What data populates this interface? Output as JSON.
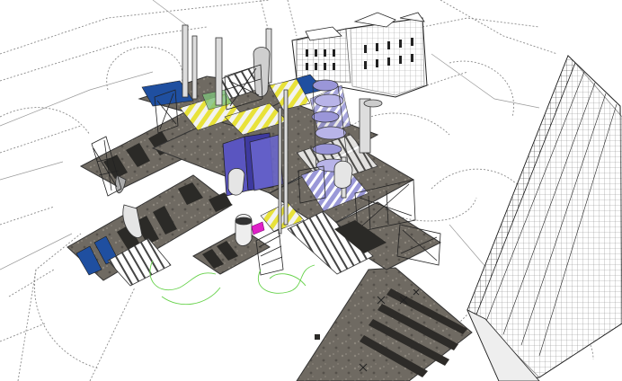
{
  "viewport": {
    "description_visible_text": ""
  },
  "scene": {
    "icons": [
      "cursor-marker-icon"
    ],
    "colors": {
      "background": "#ffffff",
      "wireframe": "#222222",
      "dashed_outline": "#8a8a8a",
      "concrete_dark": "#5a5650",
      "concrete_mid": "#7c776f",
      "concrete_light": "#a39d93",
      "blue_glass": "#3a4fa0",
      "blue_panel": "#6a66c8",
      "stripe_yellow": "#e8e23a",
      "stripe_white": "#f3f3f3",
      "purple_tower": "#7a6fd0",
      "magenta_marker": "#e020c8",
      "green_path": "#66d24a"
    }
  }
}
